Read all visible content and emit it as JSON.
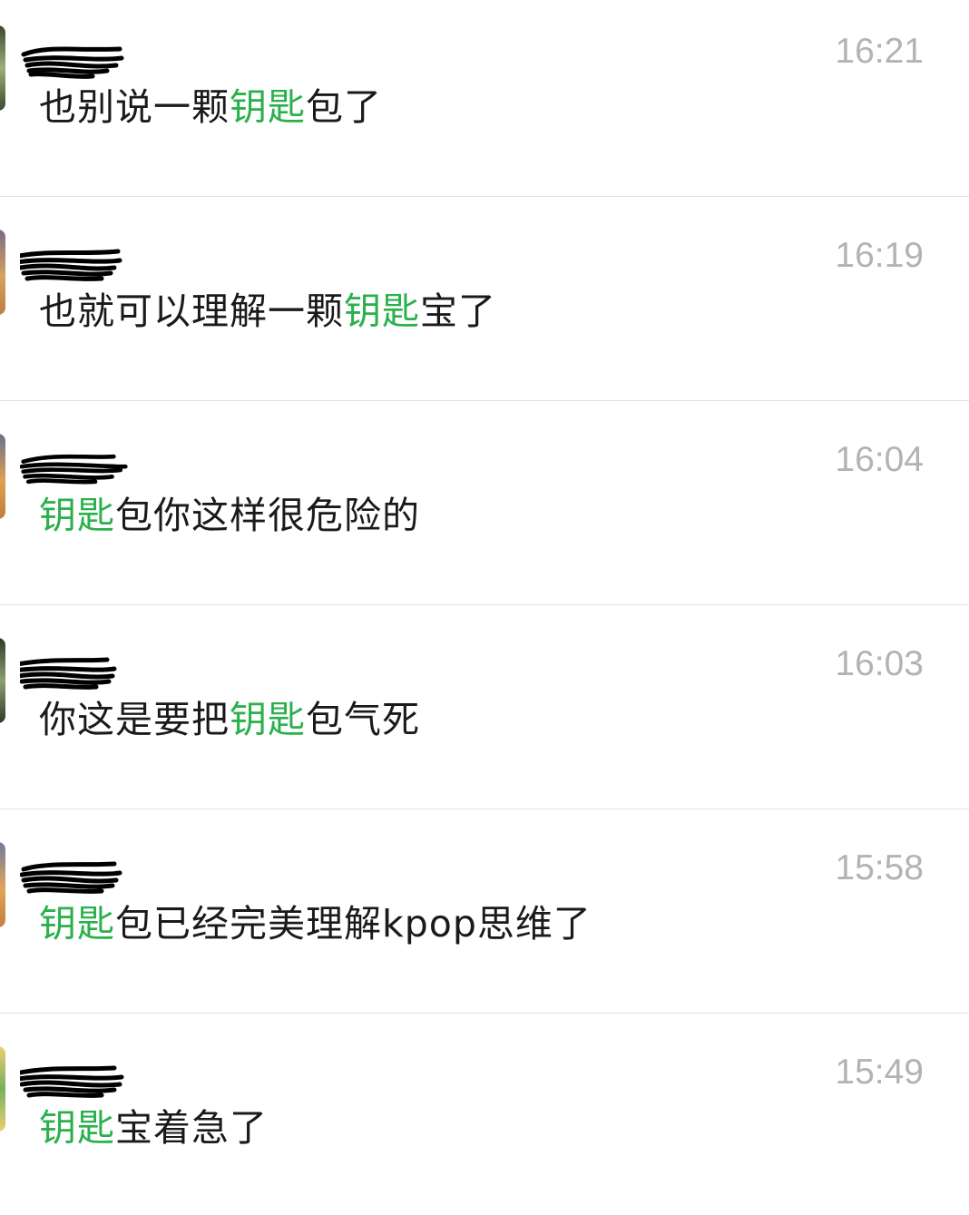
{
  "messages": [
    {
      "time": "16:21",
      "before": "也别说一颗",
      "keyword": "钥匙",
      "after": "包了",
      "avatar_colors": [
        "#3a4a2c",
        "#9ab07a"
      ]
    },
    {
      "time": "16:19",
      "before": "也就可以理解一颗",
      "keyword": "钥匙",
      "after": "宝了",
      "avatar_colors": [
        "#7a6a8a",
        "#d9a060"
      ]
    },
    {
      "time": "16:04",
      "before": "",
      "keyword": "钥匙",
      "after": "包你这样很危险的",
      "avatar_colors": [
        "#6a7090",
        "#e0a050"
      ]
    },
    {
      "time": "16:03",
      "before": "你这是要把",
      "keyword": "钥匙",
      "after": "包气死",
      "avatar_colors": [
        "#2e3a28",
        "#8aa070"
      ]
    },
    {
      "time": "15:58",
      "before": "",
      "keyword": "钥匙",
      "after": "包已经完美理解kpop思维了",
      "avatar_colors": [
        "#707a9a",
        "#e2a55a"
      ]
    },
    {
      "time": "15:49",
      "before": "",
      "keyword": "钥匙",
      "after": "宝着急了",
      "avatar_colors": [
        "#e8d070",
        "#7ab060"
      ]
    }
  ],
  "keyword_color": "#2bb04c"
}
